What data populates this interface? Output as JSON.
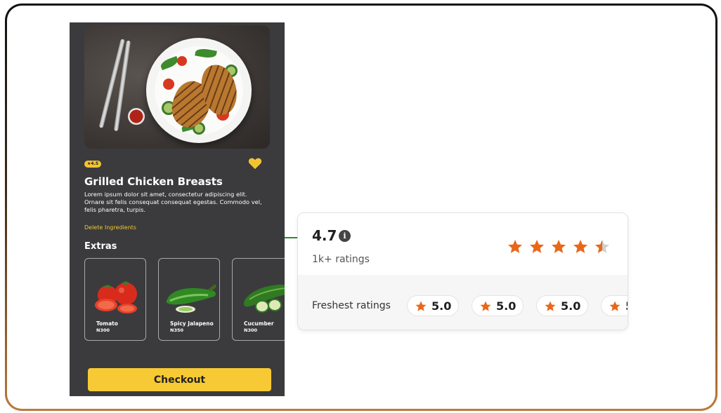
{
  "colors": {
    "accent": "#f4c430",
    "star": "#e8681a",
    "phone_bg": "#3b3b3d",
    "connector": "#2e8b2e"
  },
  "dish": {
    "rating_badge": "★4.5",
    "title": "Grilled Chicken Breasts",
    "description": "Lorem ipsum dolor sit amet, consectetur adipiscing elit. Ornare sit felis consequat consequat egestas. Commodo vel, felis pharetra, turpis.",
    "delete_label": "Delete Ingredients",
    "favorite_icon": "heart-icon"
  },
  "extras": {
    "title": "Extras",
    "items": [
      {
        "name": "Tomato",
        "price": "N300"
      },
      {
        "name": "Spicy Jalapeno",
        "price": "N350"
      },
      {
        "name": "Cucumber",
        "price": "N300"
      }
    ]
  },
  "checkout_label": "Checkout",
  "ratings": {
    "average": "4.7",
    "info_icon": "info-icon",
    "count_label": "1k+ ratings",
    "stars_value": 4.5,
    "stars_max": 5,
    "freshest_label": "Freshest ratings",
    "freshest": [
      "5.0",
      "5.0",
      "5.0",
      "5"
    ]
  }
}
